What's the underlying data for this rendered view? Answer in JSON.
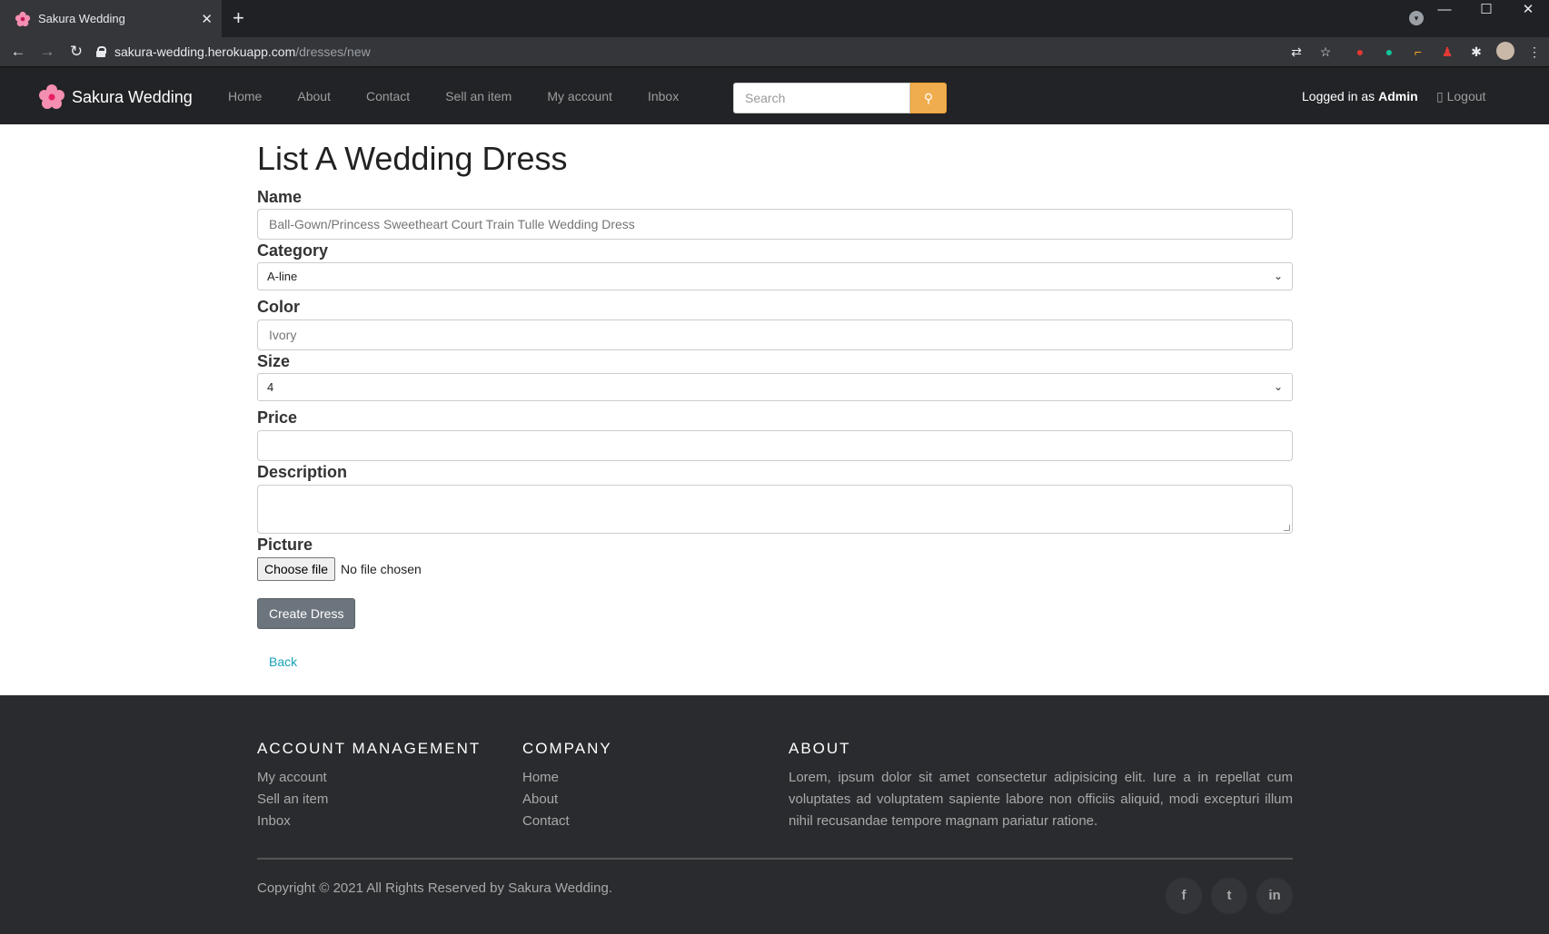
{
  "browser": {
    "tab_title": "Sakura Wedding",
    "url_host": "sakura-wedding.herokuapp.com",
    "url_path": "/dresses/new"
  },
  "nav": {
    "brand": "Sakura Wedding",
    "items": [
      {
        "label": "Home"
      },
      {
        "label": "About"
      },
      {
        "label": "Contact"
      },
      {
        "label": "Sell an item"
      },
      {
        "label": "My account"
      },
      {
        "label": "Inbox"
      }
    ],
    "search_placeholder": "Search",
    "logged_in_prefix": "Logged in as",
    "logged_in_user": "Admin",
    "logout_label": "Logout"
  },
  "form": {
    "title": "List A Wedding Dress",
    "name_label": "Name",
    "name_placeholder": "Ball-Gown/Princess Sweetheart Court Train Tulle Wedding Dress",
    "category_label": "Category",
    "category_value": "A-line",
    "color_label": "Color",
    "color_placeholder": "Ivory",
    "size_label": "Size",
    "size_value": "4",
    "price_label": "Price",
    "description_label": "Description",
    "picture_label": "Picture",
    "choose_file": "Choose file",
    "no_file": "No file chosen",
    "submit": "Create Dress",
    "back": "Back"
  },
  "footer": {
    "account_heading": "ACCOUNT MANAGEMENT",
    "account_links": [
      "My account",
      "Sell an item",
      "Inbox"
    ],
    "company_heading": "COMPANY",
    "company_links": [
      "Home",
      "About",
      "Contact"
    ],
    "about_heading": "ABOUT",
    "about_text": "Lorem, ipsum dolor sit amet consectetur adipisicing elit. Iure a in repellat cum voluptates ad voluptatem sapiente labore non officiis aliquid, modi excepturi illum nihil recusandae tempore magnam pariatur ratione.",
    "copyright": "Copyright © 2021 All Rights Reserved by Sakura Wedding.",
    "social": [
      {
        "icon": "facebook-icon",
        "glyph": "f"
      },
      {
        "icon": "twitter-icon",
        "glyph": "t"
      },
      {
        "icon": "linkedin-icon",
        "glyph": "in"
      }
    ]
  },
  "colors": {
    "navbar_bg": "#222326",
    "search_button": "#f0ad4e",
    "submit_button": "#6c757d",
    "link": "#17a2b8",
    "footer_bg": "#2a2b2e"
  }
}
